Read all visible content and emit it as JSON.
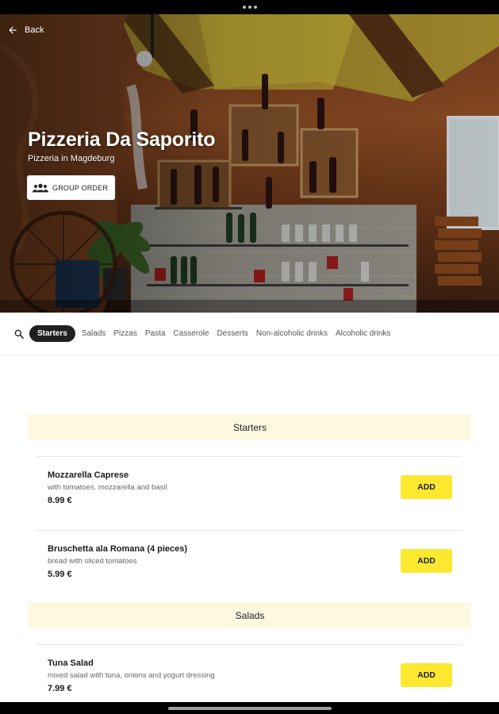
{
  "header": {
    "back_label": "Back",
    "title": "Pizzeria Da Saporito",
    "subtitle": "Pizzeria in Magdeburg",
    "group_order_label": "GROUP ORDER"
  },
  "categories": [
    {
      "label": "Starters",
      "active": true
    },
    {
      "label": "Salads"
    },
    {
      "label": "Pizzas"
    },
    {
      "label": "Pasta"
    },
    {
      "label": "Casserole"
    },
    {
      "label": "Desserts"
    },
    {
      "label": "Non-alcoholic drinks"
    },
    {
      "label": "Alcoholic drinks"
    }
  ],
  "sections": [
    {
      "title": "Starters",
      "items": [
        {
          "name": "Mozzarella Caprese",
          "description": "with tomatoes, mozzarella and basil",
          "price": "8.99 €",
          "add_label": "ADD"
        },
        {
          "name": "Bruschetta ala Romana (4 pieces)",
          "description": "bread with sliced tomatoes",
          "price": "5.99 €",
          "add_label": "ADD"
        }
      ]
    },
    {
      "title": "Salads",
      "items": [
        {
          "name": "Tuna Salad",
          "description": "mixed salad with tuna, onions and yogurt dressing",
          "price": "7.99 €",
          "add_label": "ADD"
        }
      ]
    }
  ],
  "colors": {
    "accent_yellow": "#fde830",
    "section_bg": "#fdf9e1",
    "active_chip": "#202020"
  },
  "icons": {
    "back": "arrow-left-icon",
    "group": "group-icon",
    "search": "search-icon"
  }
}
